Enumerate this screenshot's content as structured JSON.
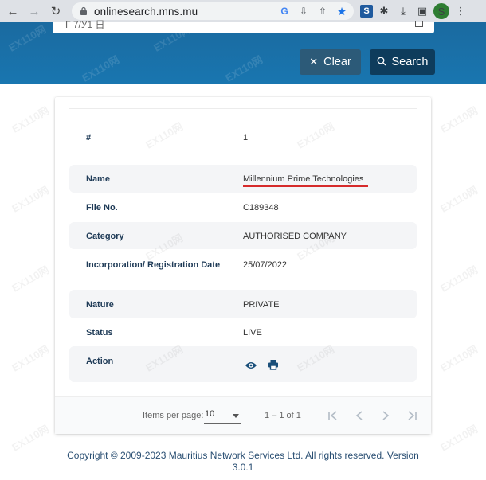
{
  "browser": {
    "url": "onlinesearch.mns.mu",
    "avatar_letter": "S"
  },
  "header": {
    "partial_input_text": "Г 7/У1 日",
    "clear_label": "Clear",
    "search_label": "Search"
  },
  "record": {
    "index_label": "#",
    "index_value": "1",
    "rows": [
      {
        "label": "Name",
        "value": "Millennium Prime Technologies"
      },
      {
        "label": "File No.",
        "value": "C189348"
      },
      {
        "label": "Category",
        "value": "AUTHORISED COMPANY"
      },
      {
        "label": "Incorporation/ Registration Date",
        "value": "25/07/2022"
      },
      {
        "label": "Nature",
        "value": "PRIVATE"
      },
      {
        "label": "Status",
        "value": "LIVE"
      },
      {
        "label": "Action",
        "value": ""
      }
    ]
  },
  "paginator": {
    "items_per_page_label": "Items per page:",
    "items_per_page_value": "10",
    "range_label": "1 – 1 of 1"
  },
  "footer": {
    "copyright": "Copyright © 2009-2023 Mauritius Network Services Ltd. All rights reserved. Version 3.0.1"
  },
  "colors": {
    "header_blue": "#1976b0",
    "search_button": "#0e3c5c",
    "clear_button": "#2c5a78",
    "highlight_underline": "#d62b2b",
    "label_color": "#1f3b57"
  }
}
